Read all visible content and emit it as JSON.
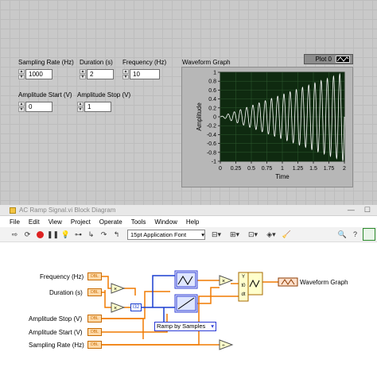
{
  "front_panel": {
    "controls": [
      {
        "label": "Sampling Rate (Hz)",
        "value": "1000"
      },
      {
        "label": "Duration (s)",
        "value": "2"
      },
      {
        "label": "Frequency (Hz)",
        "value": "10"
      },
      {
        "label": "Amplitude Start (V)",
        "value": "0"
      },
      {
        "label": "Amplitude Stop (V)",
        "value": "1"
      }
    ],
    "graph": {
      "title": "Waveform Graph",
      "legend": "Plot 0",
      "ylabel": "Amplitude",
      "xlabel": "Time",
      "yticks": [
        "1",
        "0.8",
        "0.6",
        "0.4",
        "0.2",
        "0",
        "-0.2",
        "-0.4",
        "-0.6",
        "-0.8",
        "-1"
      ],
      "xticks": [
        "0",
        "0.25",
        "0.5",
        "0.75",
        "1",
        "1.25",
        "1.5",
        "1.75",
        "2"
      ],
      "plot_bg": "#0f2a10",
      "trace_color": "#ffffff"
    }
  },
  "block_diagram": {
    "title": "AC Ramp Signal.vi Block Diagram",
    "menu": [
      "File",
      "Edit",
      "View",
      "Project",
      "Operate",
      "Tools",
      "Window",
      "Help"
    ],
    "font_select": "15pt Application Font",
    "terminals": [
      "Frequency (Hz)",
      "Duration (s)",
      "Amplitude Stop (V)",
      "Amplitude Start (V)",
      "Sampling Rate (Hz)"
    ],
    "terminal_type": "DBL",
    "indicator": "Waveform Graph",
    "ramp_mode": "Ramp by Samples",
    "convert_label": "I32",
    "build_labels": [
      "Y",
      "t0",
      "dt"
    ],
    "wire_color": "#f07a00",
    "int_wire_color": "#1a3fd1"
  },
  "chart_data": {
    "type": "line",
    "xlabel": "Time",
    "ylabel": "Amplitude",
    "xlim": [
      0,
      2
    ],
    "ylim": [
      -1,
      1
    ],
    "signal": {
      "frequency_hz": 10,
      "amplitude_start": 0,
      "amplitude_stop": 1,
      "duration_s": 2
    }
  }
}
